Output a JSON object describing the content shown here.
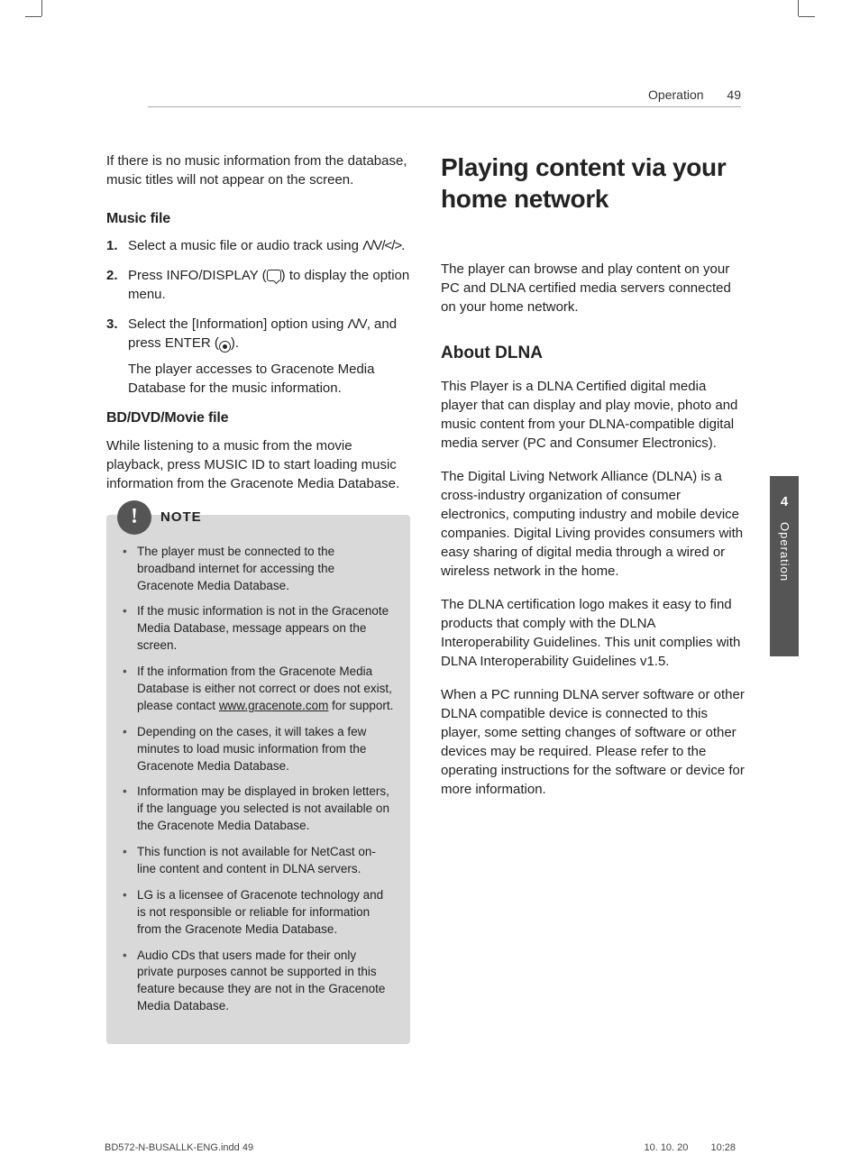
{
  "header": {
    "section": "Operation",
    "page_number": "49"
  },
  "side_tab": {
    "chapter": "4",
    "label": "Operation"
  },
  "left": {
    "intro": "If there is no music information from the database, music titles will not appear on the screen.",
    "music_file_heading": "Music file",
    "steps": [
      {
        "text_a": "Select a music file or audio track using ",
        "text_b": "."
      },
      {
        "text_a": "Press INFO/DISPLAY (",
        "text_b": ") to display the option menu."
      },
      {
        "text_a": "Select the [Information] option using ",
        "text_b": ", and press ENTER (",
        "text_c": ").",
        "extra": "The player accesses to Gracenote Media Database for the music information."
      }
    ],
    "bd_heading": "BD/DVD/Movie file",
    "bd_text": "While listening to a music from the movie playback, press MUSIC ID to start loading music information from the Gracenote Media Database.",
    "note_title": "NOTE",
    "notes": [
      "The player must be connected to the broadband internet for accessing the Gracenote Media Database.",
      "If the music information is not in the Gracenote Media Database, message appears on the screen.",
      {
        "pre": "If the information from the Gracenote Media Database is either not correct or does not exist, please contact ",
        "link": "www.gracenote.com",
        "post": " for support."
      },
      "Depending on the cases, it will takes a few minutes to load music information from the Gracenote Media Database.",
      "Information may be displayed in broken letters, if the language you selected is not available on the Gracenote Media Database.",
      "This function is not available for NetCast on-line content and content in DLNA servers.",
      "LG is a licensee of Gracenote technology and is not responsible or reliable for information from the Gracenote Media Database.",
      "Audio CDs that users made for their only private purposes cannot be supported in this feature because they are not in the Gracenote Media Database."
    ]
  },
  "right": {
    "title": "Playing content via your home network",
    "intro": "The player can browse and play content on your PC and DLNA certified media servers connected on your home network.",
    "about_heading": "About DLNA",
    "paras": [
      "This Player is a DLNA Certified digital media player that can display and play movie, photo and music content from your DLNA-compatible digital media server (PC and Consumer Electronics).",
      "The Digital Living Network Alliance (DLNA) is a cross-industry organization of consumer electronics, computing industry and mobile device companies. Digital Living provides consumers with easy sharing of digital media through a wired or wireless network in the home.",
      "The DLNA certification logo makes it easy to find products that comply with the DLNA Interoperability Guidelines. This unit complies with DLNA Interoperability Guidelines v1.5.",
      "When a PC running DLNA server software or other DLNA compatible device is connected to this player, some setting changes of software or other devices may be required. Please refer to the operating instructions for the software or device for more information."
    ]
  },
  "footer": {
    "filename": "BD572-N-BUSALLK-ENG.indd   49",
    "date": "10. 10. 20",
    "time": "10:28"
  },
  "glyphs": {
    "nav4": "Λ/V/</>",
    "nav2": "Λ/V"
  }
}
